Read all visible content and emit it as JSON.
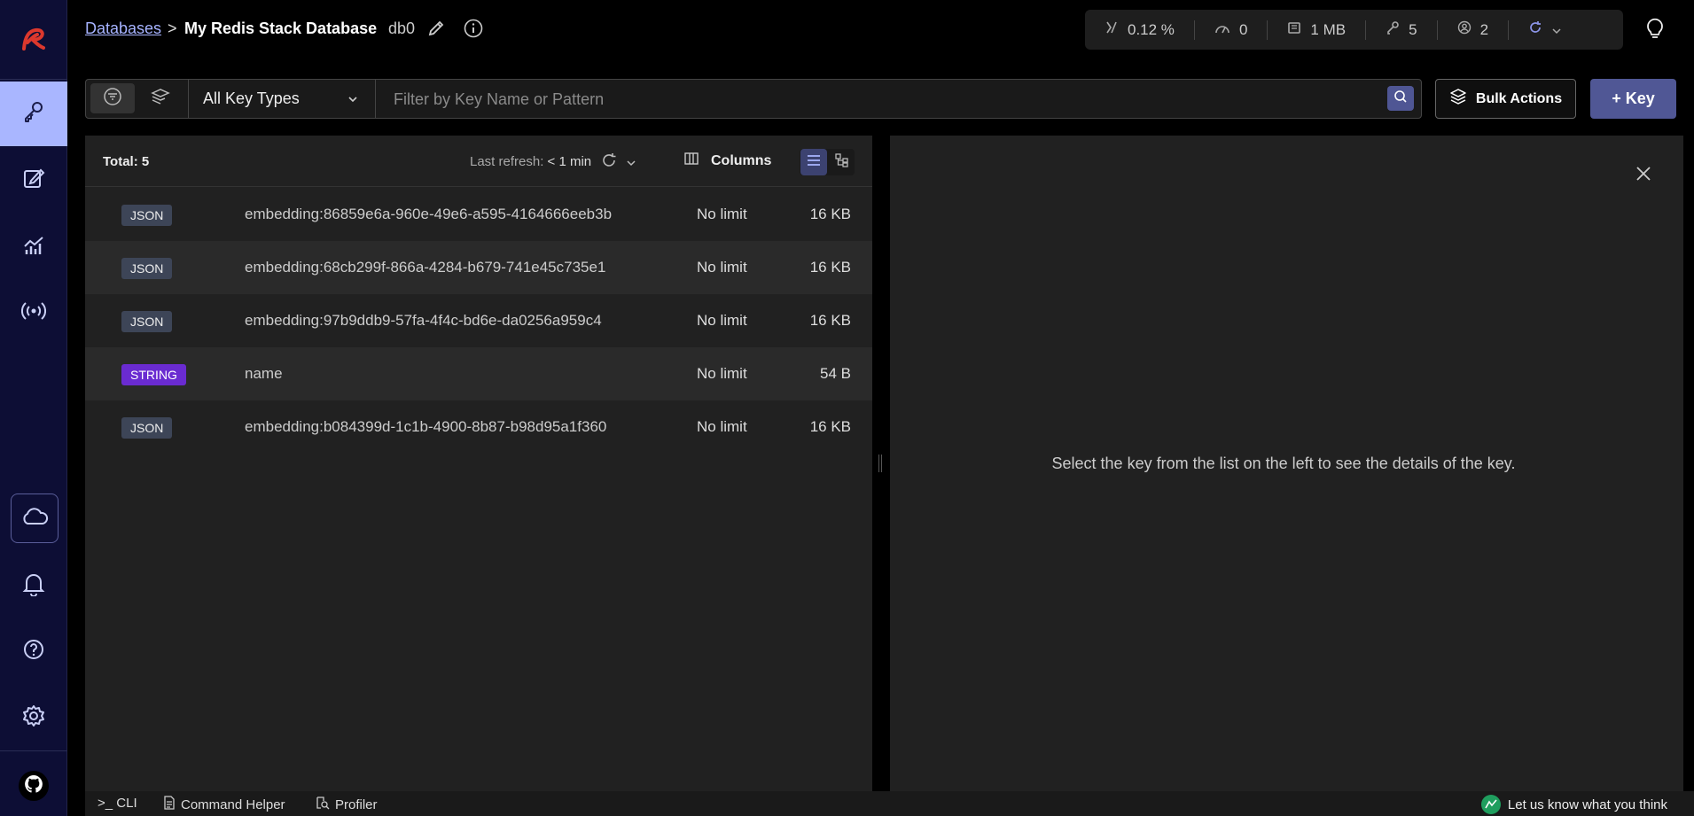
{
  "header": {
    "breadcrumb_root": "Databases",
    "breadcrumb_sep": ">",
    "database_name": "My Redis Stack Database",
    "db_index": "db0"
  },
  "stats": {
    "cpu": "0.12 %",
    "ops": "0",
    "memory": "1 MB",
    "keys": "5",
    "clients": "2"
  },
  "filter": {
    "key_type": "All Key Types",
    "placeholder": "Filter by Key Name or Pattern",
    "bulk_actions": "Bulk Actions",
    "add_key": "+ Key"
  },
  "list": {
    "total": "Total: 5",
    "last_refresh_label": "Last refresh:",
    "last_refresh_value": "< 1 min",
    "columns_label": "Columns",
    "rows": [
      {
        "type": "JSON",
        "name": "embedding:86859e6a-960e-49e6-a595-4164666eeb3b",
        "ttl": "No limit",
        "size": "16 KB"
      },
      {
        "type": "JSON",
        "name": "embedding:68cb299f-866a-4284-b679-741e45c735e1",
        "ttl": "No limit",
        "size": "16 KB"
      },
      {
        "type": "JSON",
        "name": "embedding:97b9ddb9-57fa-4f4c-bd6e-da0256a959c4",
        "ttl": "No limit",
        "size": "16 KB"
      },
      {
        "type": "STRING",
        "name": "name",
        "ttl": "No limit",
        "size": "54 B"
      },
      {
        "type": "JSON",
        "name": "embedding:b084399d-1c1b-4900-8b87-b98d95a1f360",
        "ttl": "No limit",
        "size": "16 KB"
      }
    ]
  },
  "details": {
    "placeholder": "Select the key from the list on the left to see the details of the key."
  },
  "bottom": {
    "cli": ">_ CLI",
    "command_helper": "Command Helper",
    "profiler": "Profiler",
    "feedback": "Let us know what you think"
  },
  "colors": {
    "sidebar_bg": "#0d0e35",
    "active_nav": "#a9b6ff",
    "accent": "#505795",
    "string_tag": "#6a2bd1",
    "json_tag": "#3d4557",
    "logo_red": "#dc382d"
  },
  "icons": {
    "sidebar": [
      "redis-logo-icon",
      "key-icon",
      "workbench-edit-icon",
      "analytics-chart-icon",
      "pubsub-broadcast-icon",
      "cloud-icon",
      "bell-icon",
      "help-icon",
      "gear-icon",
      "github-icon"
    ]
  }
}
